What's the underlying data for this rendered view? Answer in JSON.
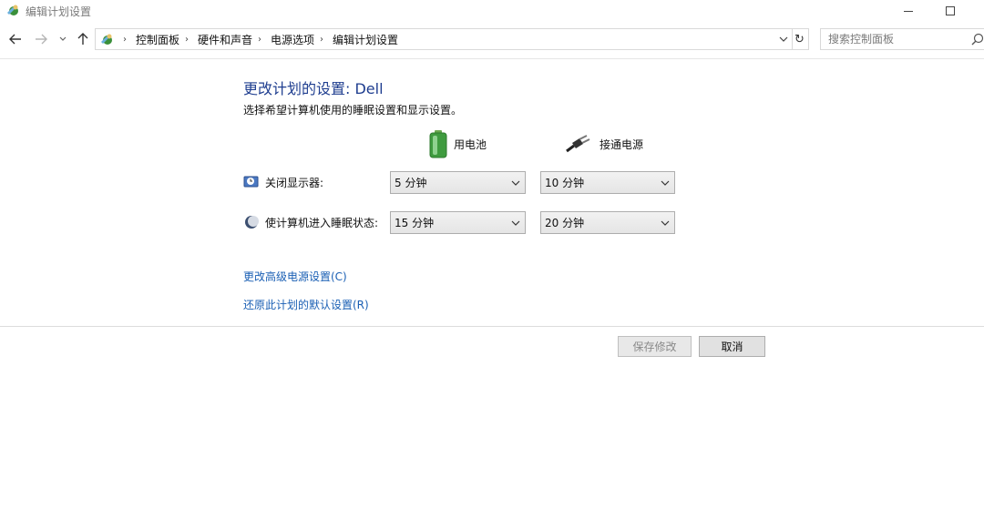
{
  "window": {
    "title": "编辑计划设置"
  },
  "nav": {
    "breadcrumbs": [
      "控制面板",
      "硬件和声音",
      "电源选项",
      "编辑计划设置"
    ],
    "search_placeholder": "搜索控制面板"
  },
  "content": {
    "heading": "更改计划的设置: Dell",
    "subtitle": "选择希望计算机使用的睡眠设置和显示设置。",
    "columns": {
      "battery": "用电池",
      "plugged_in": "接通电源"
    },
    "rows": [
      {
        "label": "关闭显示器:",
        "battery_value": "5 分钟",
        "plugged_value": "10 分钟"
      },
      {
        "label": "使计算机进入睡眠状态:",
        "battery_value": "15 分钟",
        "plugged_value": "20 分钟"
      }
    ],
    "links": {
      "advanced": "更改高级电源设置(C)",
      "restore": "还原此计划的默认设置(R)"
    }
  },
  "buttons": {
    "save": "保存修改",
    "cancel": "取消"
  },
  "colors": {
    "heading": "#1e3d8f",
    "link": "#1a5fb4"
  }
}
